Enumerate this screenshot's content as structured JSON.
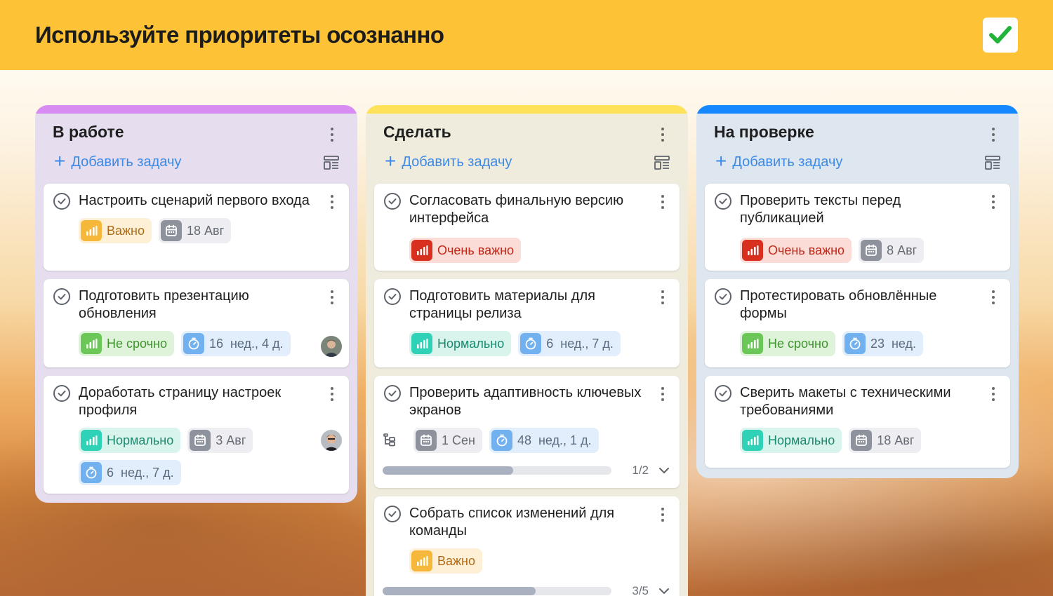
{
  "header": {
    "title": "Используйте приоритеты осознанно"
  },
  "columns": [
    {
      "title": "В работе",
      "add_label": "Добавить задачу",
      "accent": "#d68cf0",
      "cards": [
        {
          "title": "Настроить сценарий первого входа",
          "priority": "Важно",
          "date": "18 Авг"
        },
        {
          "title": "Подготовить презентацию обновления",
          "priority": "Не срочно",
          "estimate": "16  нед., 4 д."
        },
        {
          "title": "Доработать страницу настроек профиля",
          "priority": "Нормально",
          "date": "3 Авг",
          "estimate": "6  нед., 7 д."
        }
      ]
    },
    {
      "title": "Сделать",
      "add_label": "Добавить задачу",
      "accent": "#fde25a",
      "cards": [
        {
          "title": "Согласовать финальную версию интерфейса",
          "priority": "Очень важно"
        },
        {
          "title": "Подготовить материалы для страницы релиза",
          "priority": "Нормально",
          "estimate": "6  нед., 7 д."
        },
        {
          "title": "Проверить адаптивность ключевых экранов",
          "date": "1 Сен",
          "estimate": "48  нед., 1 д.",
          "progress": 0.57,
          "progress_label": "1/2"
        },
        {
          "title": "Собрать список изменений для команды",
          "priority": "Важно",
          "progress": 0.67,
          "progress_label": "3/5"
        }
      ]
    },
    {
      "title": "На проверке",
      "add_label": "Добавить задачу",
      "accent": "#1488ff",
      "cards": [
        {
          "title": "Проверить тексты перед публикацией",
          "priority": "Очень важно",
          "date": "8 Авг"
        },
        {
          "title": "Протестировать обновлённые формы",
          "priority": "Не срочно",
          "estimate": "23  нед."
        },
        {
          "title": "Сверить макеты с техническими требованиями",
          "priority": "Нормально",
          "date": "18 Авг"
        }
      ]
    }
  ],
  "icons": {
    "check": "check-icon",
    "task": "circle-check-icon",
    "more": "more-vertical-icon",
    "plus": "plus-icon",
    "layout": "layout-icon",
    "priority": "bar-chart-icon",
    "calendar": "calendar-icon",
    "timer": "stopwatch-icon",
    "subtasks": "subtasks-icon",
    "expand": "chevron-down-icon"
  },
  "colors": {
    "header": "#fdc236",
    "important": "#f6b83a",
    "very_important": "#d7301f",
    "normal": "#2fd2b6",
    "not_urgent": "#6bc757",
    "link": "#3d8ae6"
  }
}
